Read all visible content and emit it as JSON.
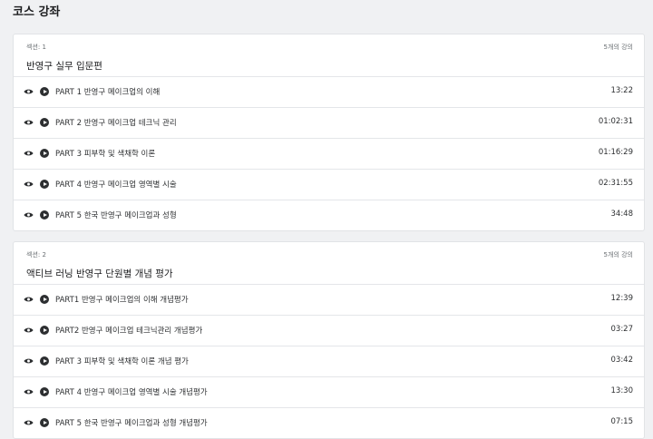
{
  "page": {
    "title": "코스 강좌"
  },
  "sections": [
    {
      "label": "섹션: 1",
      "count": "5개의 강의",
      "title": "반영구 실무 입문편",
      "lectures": [
        {
          "title": "PART 1 반영구 메이크업의 이해",
          "duration": "13:22"
        },
        {
          "title": "PART 2 반영구 메이크업 테크닉 관리",
          "duration": "01:02:31"
        },
        {
          "title": "PART 3 피부학 및 색채학 이론",
          "duration": "01:16:29"
        },
        {
          "title": "PART 4 반영구 메이크업 영역별 시술",
          "duration": "02:31:55"
        },
        {
          "title": "PART 5 한국 반영구 메이크업과 성형",
          "duration": "34:48"
        }
      ]
    },
    {
      "label": "섹션: 2",
      "count": "5개의 강의",
      "title": "액티브 러닝 반영구 단원별 개념 평가",
      "lectures": [
        {
          "title": "PART1 반영구 메이크업의 이해 개념평가",
          "duration": "12:39"
        },
        {
          "title": "PART2 반영구 메이크업 테크닉관리 개념평가",
          "duration": "03:27"
        },
        {
          "title": "PART 3 피부학 및 색채학 이론 개념 평가",
          "duration": "03:42"
        },
        {
          "title": "PART 4 반영구 메이크업 영역별 시술 개념평가",
          "duration": "13:30"
        },
        {
          "title": "PART 5 한국 반영구 메이크업과 성형 개념평가",
          "duration": "07:15"
        }
      ]
    }
  ],
  "icons": {
    "preview": "eye-icon",
    "play": "play-icon"
  },
  "colors": {
    "background": "#f0f1f3",
    "card": "#ffffff",
    "text": "#1c1d1f",
    "icon": "#2d2f31"
  }
}
